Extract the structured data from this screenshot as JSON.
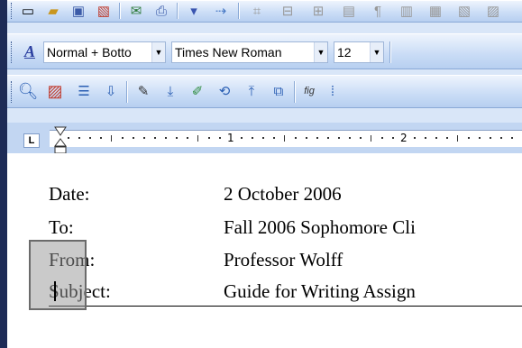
{
  "format_toolbar": {
    "style": "Normal + Botto",
    "font": "Times New Roman",
    "size": "12"
  },
  "ruler": {
    "numbers": [
      "1",
      "2"
    ]
  },
  "memo": {
    "rows": [
      {
        "label": "Date:",
        "value": "2 October 2006"
      },
      {
        "label": "To:",
        "value": "Fall 2006 Sophomore Cli"
      },
      {
        "label": "From:",
        "value": "Professor Wolff"
      },
      {
        "label": "Subject:",
        "value": "Guide for Writing Assign"
      }
    ]
  },
  "colors": {
    "toolbar_light": "#eef4fd",
    "toolbar_dark": "#b7cff0",
    "accent": "#1d2b56"
  },
  "icons": {
    "toolbar1": [
      "new-document-icon",
      "open-folder-icon",
      "save-icon",
      "permission-icon",
      "email-icon",
      "print-icon",
      "undo-icon",
      "redo-icon",
      "table-icon"
    ],
    "toolbar2": [
      "styles-pane-icon"
    ],
    "toolbar3": [
      "zoom-icon",
      "picture-icon",
      "numbering-icon",
      "insert-icon",
      "edit-pen-icon",
      "download-icon",
      "highlight-icon",
      "track-changes-icon",
      "upload-icon",
      "copy-icon",
      "figure-caption-icon"
    ]
  }
}
